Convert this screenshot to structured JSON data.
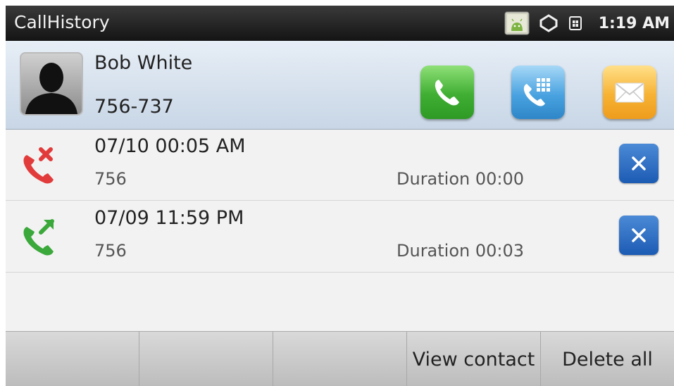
{
  "status_bar": {
    "app_title": "CallHistory",
    "time": "1:19 AM",
    "icons": [
      "android-notification-icon",
      "sync-icon",
      "sim-icon"
    ]
  },
  "contact": {
    "name": "Bob White",
    "number": "756-737",
    "actions": [
      {
        "name": "call",
        "icon": "phone-icon",
        "color": "#3fae32"
      },
      {
        "name": "dial",
        "icon": "dialpad-icon",
        "color": "#4aa3e0"
      },
      {
        "name": "message",
        "icon": "envelope-icon",
        "color": "#f7b234"
      }
    ]
  },
  "calls": [
    {
      "type": "missed",
      "icon": "missed-call-icon",
      "datetime": "07/10 00:05 AM",
      "number": "756",
      "duration": "Duration 00:00",
      "color": "#e23b3b"
    },
    {
      "type": "outgoing",
      "icon": "outgoing-call-icon",
      "datetime": "07/09 11:59 PM",
      "number": "756",
      "duration": "Duration 00:03",
      "color": "#3aa83a"
    }
  ],
  "menu": [
    "",
    "",
    "",
    "View contact",
    "Delete all"
  ]
}
